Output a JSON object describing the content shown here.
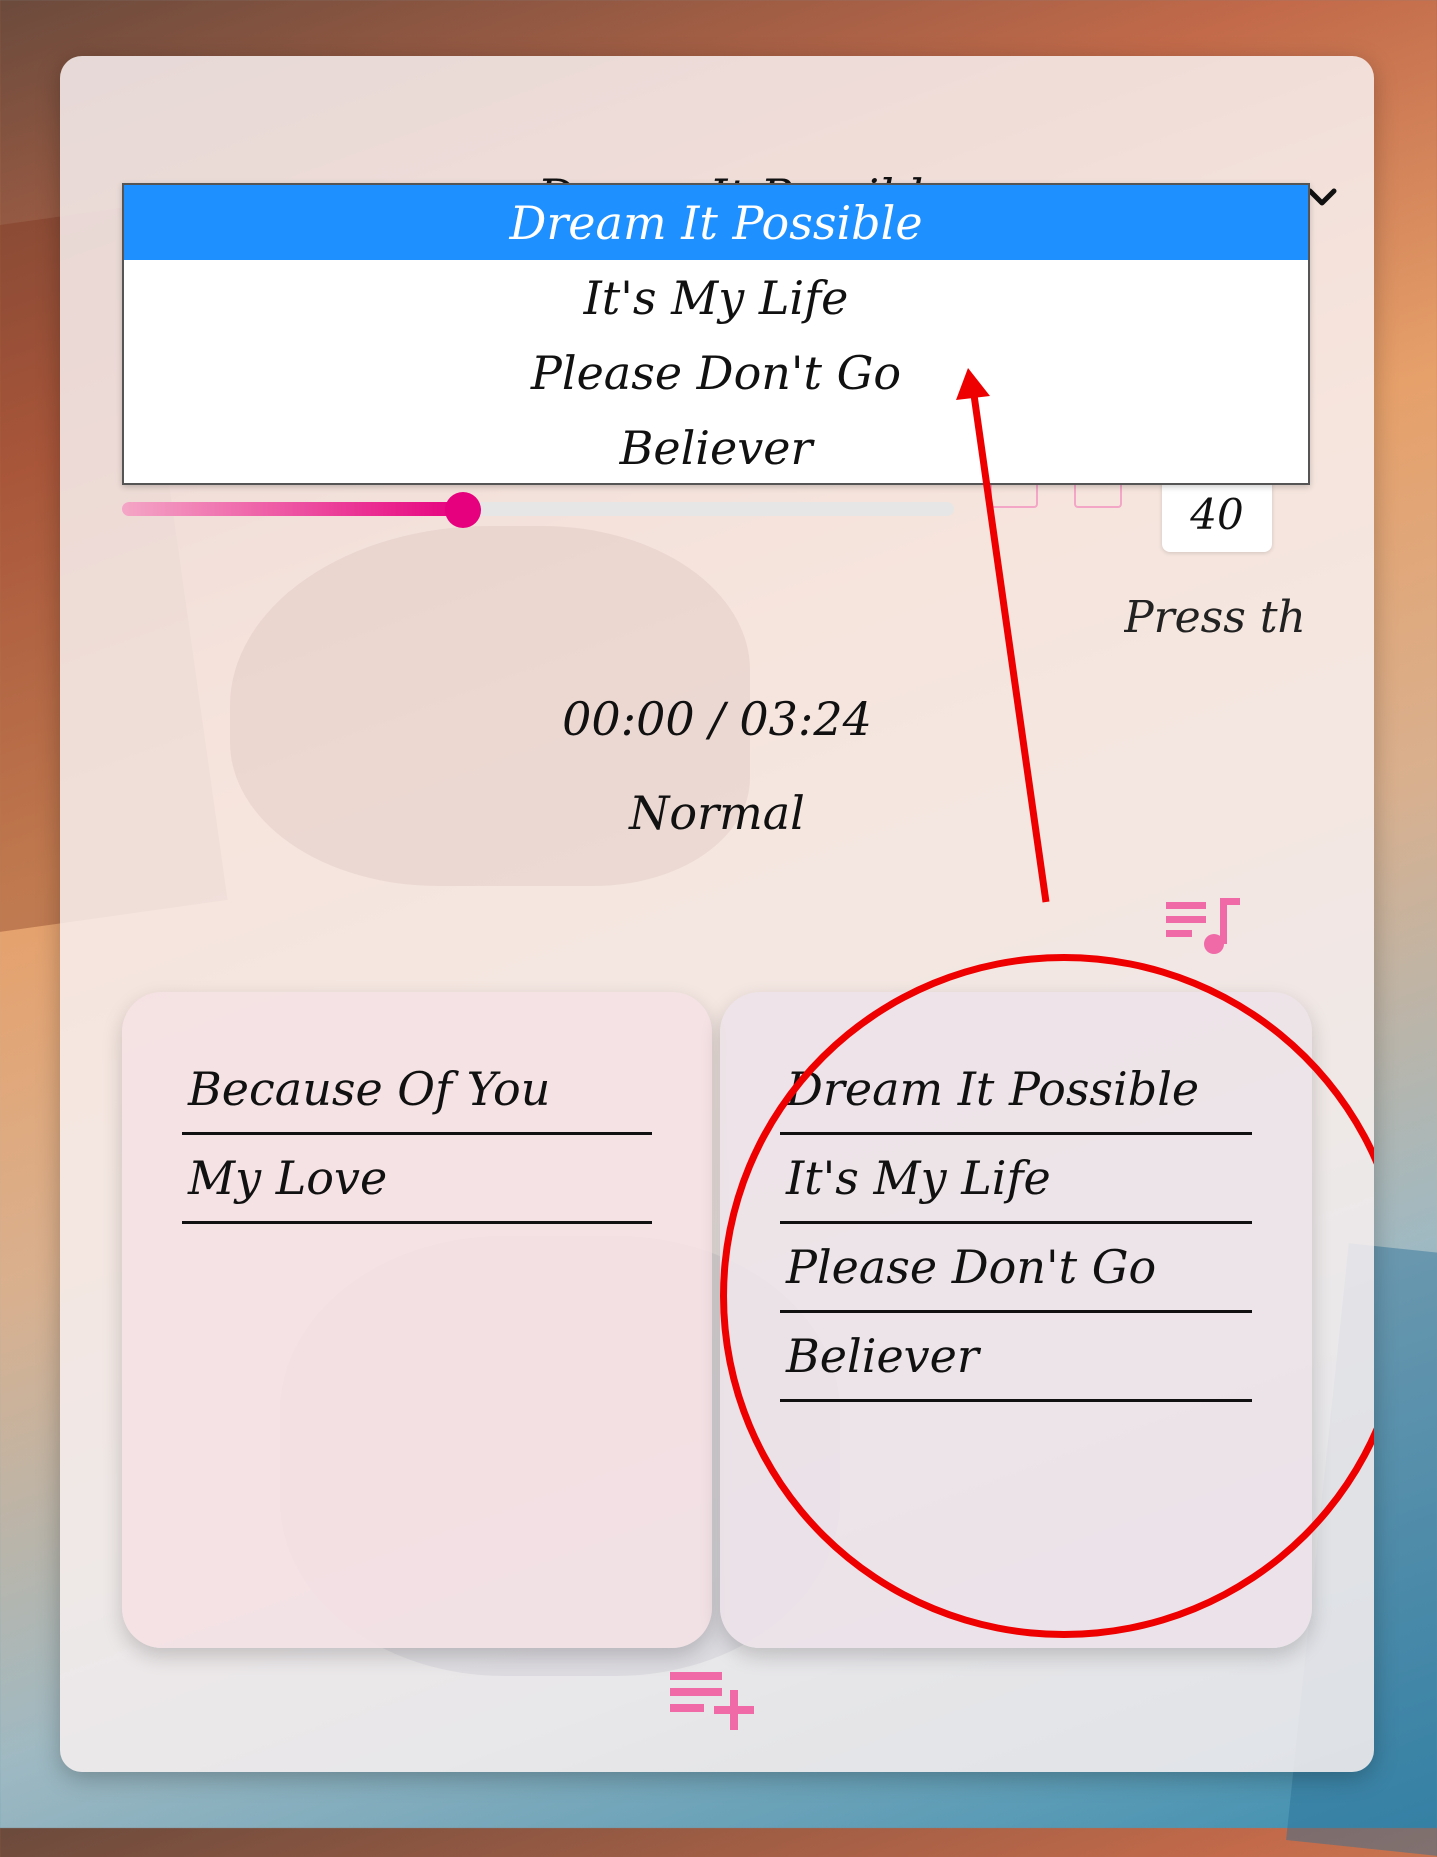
{
  "player": {
    "current_song": "Dream It Possible",
    "options": [
      "Dream It Possible",
      "It's My Life",
      "Please Don't Go",
      "Believer"
    ],
    "selected_index": 0,
    "progress_fraction": 0.41,
    "volume": "40",
    "hint_text": "Press th",
    "time": "00:00 / 03:24",
    "mode": "Normal"
  },
  "lists": {
    "left": [
      "Because Of You",
      "My Love"
    ],
    "right": [
      "Dream It Possible",
      "It's My Life",
      "Please Don't Go",
      "Believer"
    ]
  },
  "colors": {
    "accent": "#e6007e",
    "accent_light": "#f4a6c6",
    "selected_option": "#1e90ff",
    "annotation": "#ee0000"
  },
  "icons": {
    "dropdown": "chevron-down-icon",
    "playlist": "playlist-music-icon",
    "add": "playlist-add-icon"
  }
}
